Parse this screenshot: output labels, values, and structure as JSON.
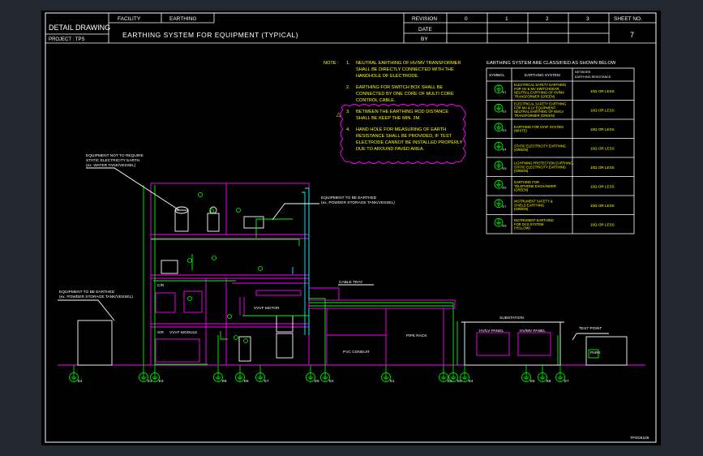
{
  "title_block": {
    "detail_drawing": "DETAIL DRAWING",
    "project": "PROJECT : TPS",
    "facility_label": "FACILITY",
    "facility_value": "EARTHING",
    "drawing_title": "EARTHING SYSTEM FOR EQUIPMENT (TYPICAL)",
    "revision_label": "REVISION",
    "revisions": [
      "0",
      "1",
      "2",
      "3"
    ],
    "date_label": "DATE",
    "by_label": "BY",
    "sheet_label": "SHEET NO.",
    "sheet_no": "7"
  },
  "notes": {
    "heading": "NOTE :",
    "items": [
      {
        "num": "1.",
        "lines": [
          "NEUTRAL EARTHING OF HV/MV TRANSFORMER",
          "SHALL BE DIRECTLY CONNECTED WITH THE",
          "HANDHOLE OF ELECTRODE."
        ]
      },
      {
        "num": "2.",
        "lines": [
          "EARTHING FOR SWITCH BOX SHALL BE",
          "CONNECTED BY ONE CORE OF MULTI CORE",
          "CONTROL CABLE."
        ]
      },
      {
        "num": "3.",
        "lines": [
          "BETWEEN THE EARTHING ROD DISTANCE",
          "SHALL BE KEEP THE MIN. 2M."
        ]
      },
      {
        "num": "4.",
        "lines": [
          "HAND HOLE FOR MEASURING OF EARTH",
          "RESISTANCE SHALL BE PROVIDED, IF TEST",
          "ELECTRODE CANNOT BE INSTALLED PROPERLY",
          "DUE TO AROUND PAVED AREA."
        ]
      }
    ]
  },
  "classification": {
    "heading": "EARTHING SYSTEM ARE CLASSIFIED AS SHOWN BELOW",
    "headers": {
      "symbol": "SYMBOL",
      "system": "EARTHING SYSTEM",
      "resistance": [
        "NETWORK",
        "EARTHING RESISTANCE"
      ]
    },
    "rows": [
      {
        "sym": "E1",
        "system": [
          "ELECTRICAL SAFETY EARTHING",
          "FOR HV & MV SWITCHGEAR,",
          "NEUTRAL EARTHING OF HV/MV",
          "TRANSFORMER (GREEN)"
        ],
        "value": "10Ω OR LESS"
      },
      {
        "sym": "E2",
        "system": [
          "ELECTRICAL SAFETY EARTHING",
          "FOR MV & LV EQUIPMENT,",
          "NEUTRAL EARTHING OF MV/LV",
          "TRANSFORMER (GREEN)"
        ],
        "value": "10Ω OR LESS"
      },
      {
        "sym": "E3",
        "system": [
          "EARTHING FOR VVVF SYSTEM",
          "(WHITE)"
        ],
        "value": "10Ω OR LESS"
      },
      {
        "sym": "E4",
        "system": [
          "STATIC ELECTRICITY EARTHING",
          "(GREEN)"
        ],
        "value": "10Ω OR LESS"
      },
      {
        "sym": "E5",
        "system": [
          "LIGHTNING PROTECTION EARTHING,",
          "STATIC ELECTRICITY EARTHING",
          "(GREEN)"
        ],
        "value": "10Ω OR LESS"
      },
      {
        "sym": "E6",
        "system": [
          "EARTHING FOR",
          "TELEPHONE EXCHANGER",
          "(GREEN)"
        ],
        "value": "10Ω OR LESS"
      },
      {
        "sym": "E7",
        "system": [
          "INSTRUMENT SAFETY &",
          "SHIELD EARTHING",
          "(GREEN)"
        ],
        "value": "10Ω OR LESS"
      },
      {
        "sym": "E8",
        "system": [
          "INSTRUMENT EARTHING",
          "FOR DCS SYSTEM",
          "(YELLOW)"
        ],
        "value": "10Ω OR LESS"
      }
    ]
  },
  "labels": {
    "equip_not_req": [
      "EQUIPMENT NOT TO REQUIRE",
      "STATIC ELECTRICITY EARTH",
      "(ex. WATER TANK/VESSEL)"
    ],
    "equip_earth_right": [
      "EQUIPMENT TO BE EARTHED",
      "(ex. POWDER STORAGE TANK/VESSEL)"
    ],
    "equip_earth_left": [
      "EQUIPMENT TO BE EARTHED",
      "(ex. POWDER STORAGE TANK/VESSEL)"
    ],
    "cable_tray": "CABLE TRAY",
    "pipe_rack": "PIPE RACK",
    "pvc_conduit": "PVC CONDUIT",
    "substation": "SUBSTATION",
    "hvlv_panel": "HV/LV PANEL",
    "hvmv_panel": "HV/MV PANEL",
    "test_point": "TEST POINT",
    "park": "PARK",
    "vvvf_motor": "VVVF MOTOR",
    "vvvf_module": "VVVF MODULE",
    "cr": "C/R",
    "sr": "S/R",
    "drawing_code": "TPSD6109"
  },
  "ground_points": [
    "E4",
    "E1",
    "E3",
    "E8",
    "E6",
    "E7",
    "E5",
    "E2",
    "E1",
    "E5",
    "E8",
    "E4",
    "E5",
    "E6",
    "E7"
  ],
  "colors": {
    "title": "#ffffff",
    "notes": "#ffff00",
    "structure": "#ff00ff",
    "earth": "#00ff00",
    "cloud": "#ff00ff",
    "pipe": "#00ffff"
  }
}
